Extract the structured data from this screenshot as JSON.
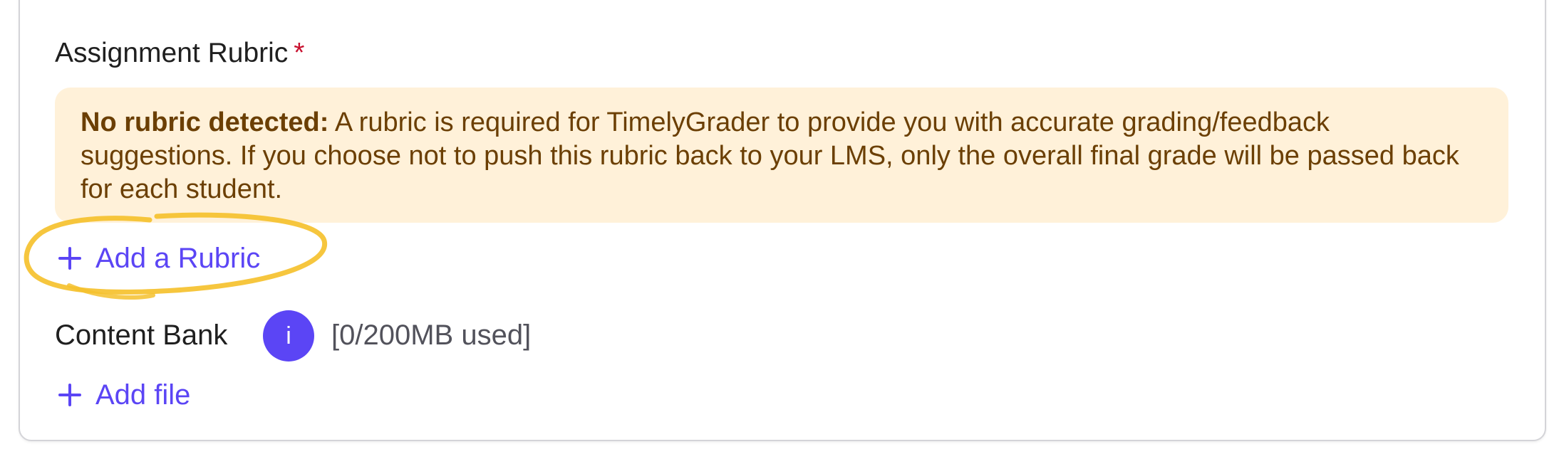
{
  "rubric_section": {
    "label": "Assignment Rubric",
    "required_marker": "*",
    "alert": {
      "title": "No rubric detected:",
      "message": "A rubric is required for TimelyGrader to provide you with accurate grading/feedback suggestions. If you choose not to push this rubric back to your LMS, only the overall final grade will be passed back for each student."
    },
    "add_rubric_label": "Add a Rubric"
  },
  "content_bank": {
    "label": "Content Bank",
    "info_icon": "i",
    "usage": "[0/200MB used]",
    "add_file_label": "Add file"
  },
  "colors": {
    "accent": "#5b45f5",
    "alert_background": "#fff1d9",
    "alert_text": "#6b3f04",
    "required": "#c8102e",
    "highlight_ring": "#f5c12e"
  },
  "icons": {
    "add": "plus-icon",
    "info": "info-icon"
  }
}
